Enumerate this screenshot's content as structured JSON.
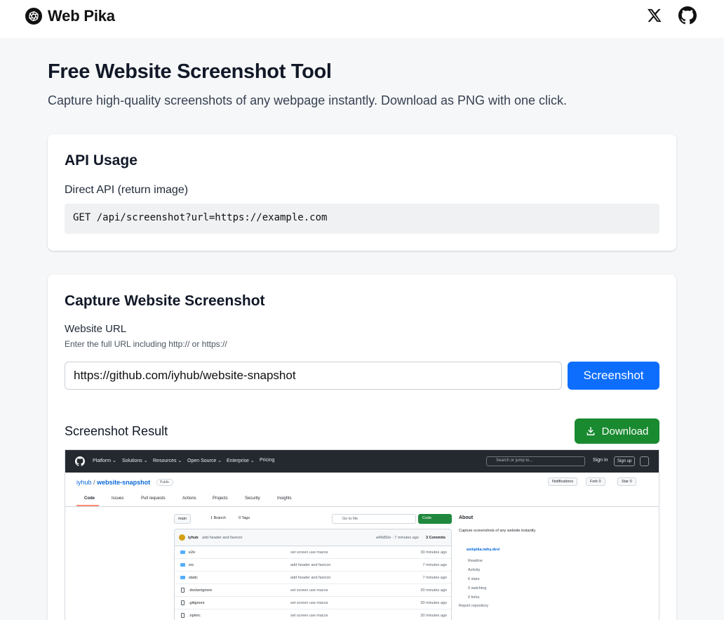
{
  "header": {
    "brand": "Web Pika",
    "icons": [
      "x-logo-icon",
      "github-icon"
    ]
  },
  "hero": {
    "title": "Free Website Screenshot Tool",
    "subtitle": "Capture high-quality screenshots of any webpage instantly. Download as PNG with one click."
  },
  "api": {
    "title": "API Usage",
    "direct_label": "Direct API (return image)",
    "code": "GET /api/screenshot?url=https://example.com"
  },
  "capture": {
    "title": "Capture Website Screenshot",
    "url_label": "Website URL",
    "url_hint": "Enter the full URL including http:// or https://",
    "url_value": "https://github.com/iyhub/website-snapshot",
    "screenshot_button": "Screenshot",
    "result_title": "Screenshot Result",
    "download_button": "Download"
  },
  "colors": {
    "primary_blue": "#0d6efd",
    "download_green": "#198a30",
    "page_bg": "#f6f7f9"
  },
  "preview": {
    "nav": [
      "Platform ⌄",
      "Solutions ⌄",
      "Resources ⌄",
      "Open Source ⌄",
      "Enterprise ⌄",
      "Pricing"
    ],
    "search_placeholder": "Search or jump to...",
    "sign_in": "Sign in",
    "sign_up": "Sign up",
    "owner": "iyhub",
    "separator": "/",
    "repo": "website-snapshot",
    "visibility": "Public",
    "notifications": "Notifications",
    "fork": "Fork",
    "fork_count": "0",
    "star": "Star",
    "star_count": "0",
    "tabs": [
      "Code",
      "Issues",
      "Pull requests",
      "Actions",
      "Projects",
      "Security",
      "Insights"
    ],
    "branch": "main",
    "branches": "1 Branch",
    "tags": "0 Tags",
    "goto_file": "Go to file",
    "code_button": "Code",
    "commit_author": "iyhub",
    "commit_message": "add header and favicon",
    "commit_meta": "a49d50e · 7 minutes ago",
    "commit_count": "3 Commits",
    "files": [
      {
        "name": "e2e",
        "type": "folder",
        "message": "set screen use macos",
        "time": "30 minutes ago"
      },
      {
        "name": "src",
        "type": "folder",
        "message": "add header and favicon",
        "time": "7 minutes ago"
      },
      {
        "name": "static",
        "type": "folder",
        "message": "add header and favicon",
        "time": "7 minutes ago"
      },
      {
        "name": ".dockerignore",
        "type": "file",
        "message": "set screen use macos",
        "time": "30 minutes ago"
      },
      {
        "name": ".gitignore",
        "type": "file",
        "message": "set screen use macos",
        "time": "30 minutes ago"
      },
      {
        "name": ".npmrc",
        "type": "file",
        "message": "set screen use macos",
        "time": "30 minutes ago"
      }
    ],
    "about": {
      "title": "About",
      "description": "Capture screenshots of any website instantly.",
      "link": "webpika.iwhy.dev/",
      "items": [
        "Readme",
        "Activity",
        "0 stars",
        "0 watching",
        "0 forks"
      ],
      "report": "Report repository"
    }
  }
}
